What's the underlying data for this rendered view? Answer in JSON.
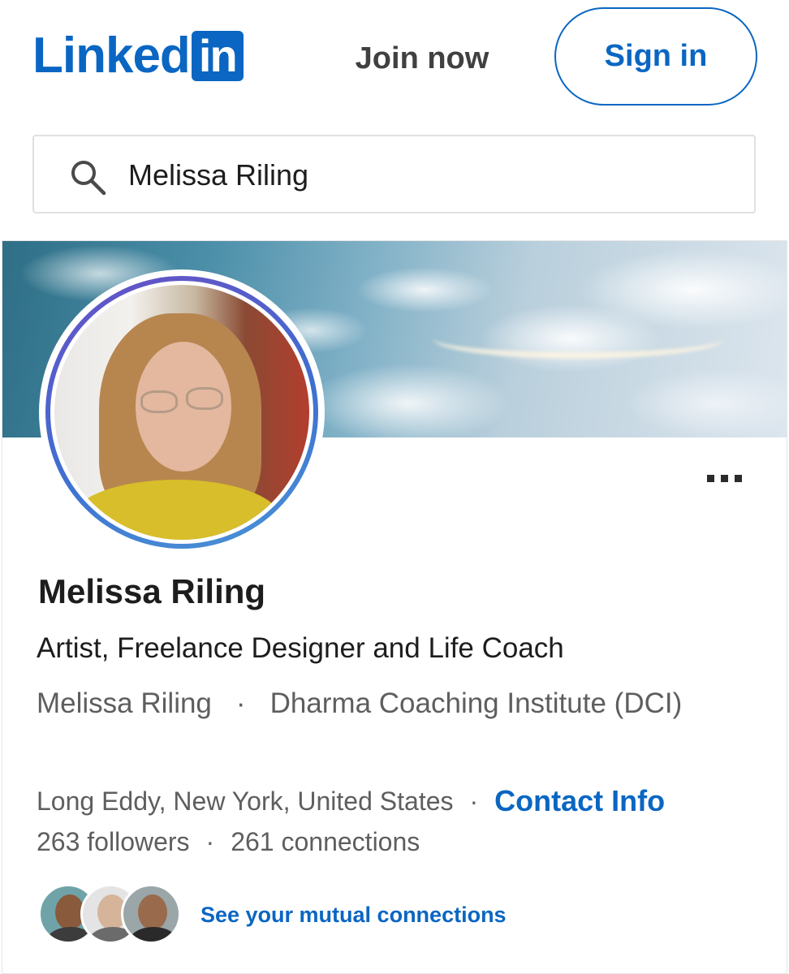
{
  "header": {
    "logo_text": "Linked",
    "logo_box_text": "in",
    "join_label": "Join now",
    "signin_label": "Sign in",
    "brand_color": "#0a66c2"
  },
  "search": {
    "value": "Melissa Riling",
    "icon": "search-icon"
  },
  "profile": {
    "name": "Melissa Riling",
    "headline": "Artist, Freelance Designer and Life Coach",
    "current_company": "Melissa Riling",
    "education": "Dharma Coaching Institute (DCI)",
    "separator": "·",
    "location": "Long Eddy, New York, United States",
    "contact_label": "Contact Info",
    "followers": "263 followers",
    "connections": "261 connections",
    "mutual_label": "See your mutual connections",
    "more_icon": "more-options-icon"
  }
}
